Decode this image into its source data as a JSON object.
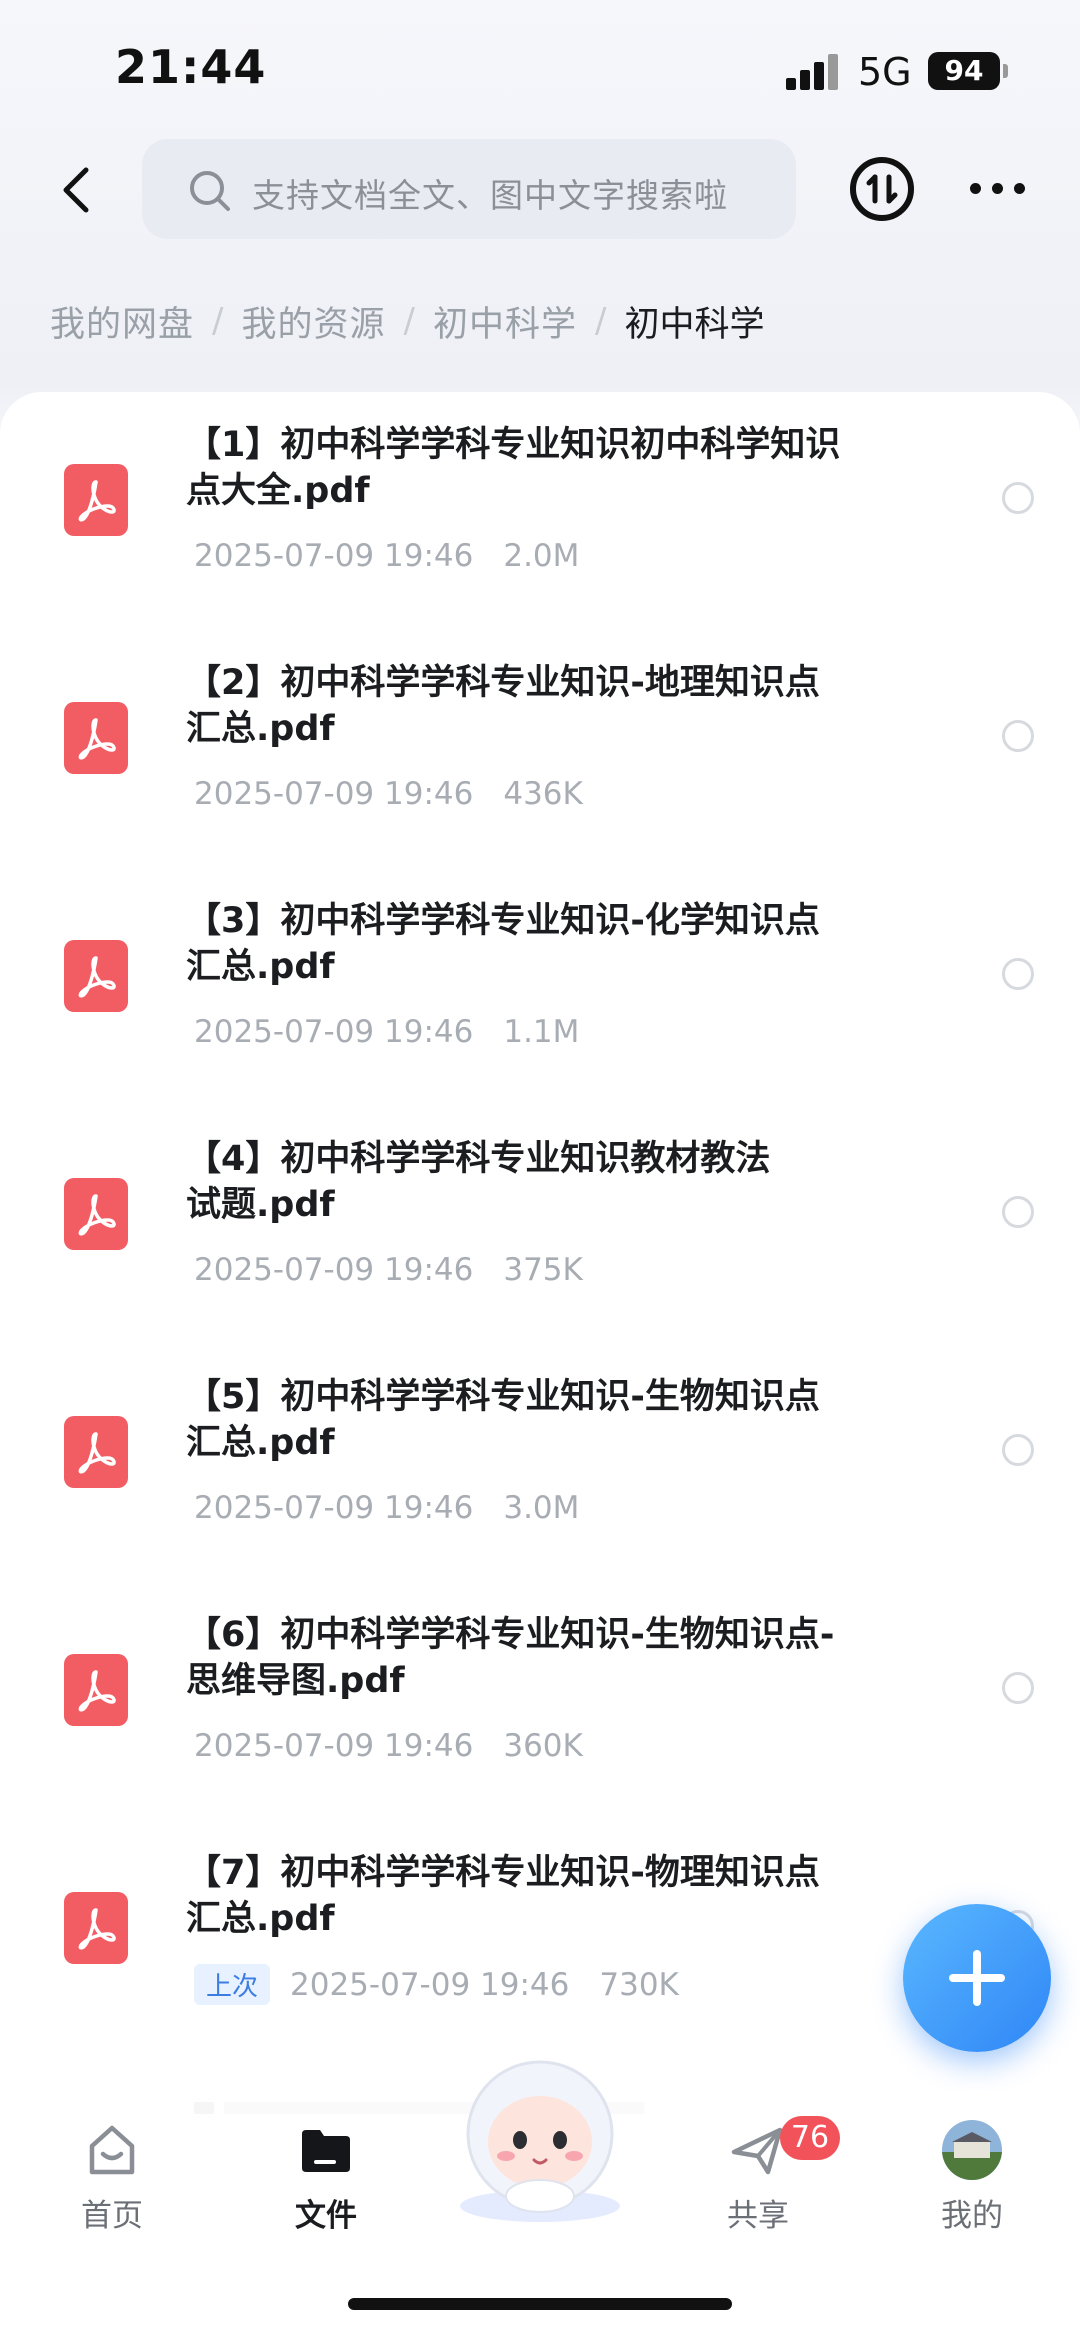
{
  "status_bar": {
    "time": "21:44",
    "network": "5G",
    "battery": "94"
  },
  "header": {
    "search_placeholder": "支持文档全文、图中文字搜索啦"
  },
  "breadcrumb": [
    {
      "label": "我的网盘"
    },
    {
      "label": "我的资源"
    },
    {
      "label": "初中科学"
    },
    {
      "label": "初中科学"
    }
  ],
  "files": [
    {
      "name_line1": "【1】初中科学学科专业知识初中科学知识",
      "name_line2": "点大全.pdf",
      "date": "2025-07-09 19:46",
      "size": "2.0M"
    },
    {
      "name_line1": "【2】初中科学学科专业知识-地理知识点",
      "name_line2": "汇总.pdf",
      "date": "2025-07-09 19:46",
      "size": "436K"
    },
    {
      "name_line1": "【3】初中科学学科专业知识-化学知识点",
      "name_line2": "汇总.pdf",
      "date": "2025-07-09 19:46",
      "size": "1.1M"
    },
    {
      "name_line1": "【4】初中科学学科专业知识教材教法",
      "name_line2": "试题.pdf",
      "date": "2025-07-09 19:46",
      "size": "375K"
    },
    {
      "name_line1": "【5】初中科学学科专业知识-生物知识点",
      "name_line2": "汇总.pdf",
      "date": "2025-07-09 19:46",
      "size": "3.0M"
    },
    {
      "name_line1": "【6】初中科学学科专业知识-生物知识点-",
      "name_line2": "思维导图.pdf",
      "date": "2025-07-09 19:46",
      "size": "360K"
    },
    {
      "name_line1": "【7】初中科学学科专业知识-物理知识点",
      "name_line2": "汇总.pdf",
      "tag": "上次",
      "date": "2025-07-09 19:46",
      "size": "730K"
    }
  ],
  "tab_bar": {
    "home": "首页",
    "files": "文件",
    "share": "共享",
    "share_badge": "76",
    "mine": "我的"
  },
  "colors": {
    "pdf_icon": "#f25c63",
    "fab": "#2f86f6",
    "badge": "#f2525a"
  }
}
